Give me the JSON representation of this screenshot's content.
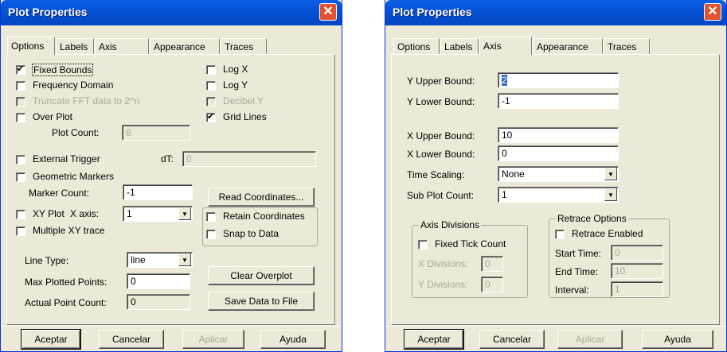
{
  "w1": {
    "title": "Plot Properties",
    "close": "✕",
    "tabs": [
      "Options",
      "Labels",
      "Axis",
      "Appearance",
      "Traces"
    ],
    "fixed_bounds": "Fixed Bounds",
    "frequency_domain": "Frequency Domain",
    "truncate_fft": "Truncate FFT data to 2^n",
    "over_plot": "Over Plot",
    "plot_count_label": "Plot Count:",
    "plot_count_value": "8",
    "log_x": "Log X",
    "log_y": "Log Y",
    "decibel_y": "Decibel Y",
    "grid_lines": "Grid Lines",
    "external_trigger": "External Trigger",
    "dt_label": "dT:",
    "dt_value": "0",
    "geometric_markers": "Geometric Markers",
    "marker_count_label": "Marker Count:",
    "marker_count_value": "-1",
    "read_coordinates": "Read Coordinates...",
    "xy_plot": "XY Plot",
    "x_axis_label": "X axis:",
    "x_axis_value": "1",
    "retain_coordinates": "Retain Coordinates",
    "multiple_xy_trace": "Multiple XY trace",
    "snap_to_data": "Snap to Data",
    "line_type_label": "Line Type:",
    "line_type_value": "line",
    "max_points_label": "Max Plotted Points:",
    "max_points_value": "0",
    "actual_count_label": "Actual Point Count:",
    "actual_count_value": "0",
    "clear_overplot": "Clear Overplot",
    "save_data": "Save Data to File",
    "ok": "Aceptar",
    "cancel": "Cancelar",
    "apply": "Aplicar",
    "help": "Ayuda"
  },
  "w2": {
    "title": "Plot Properties",
    "close": "✕",
    "tabs": [
      "Options",
      "Labels",
      "Axis",
      "Appearance",
      "Traces"
    ],
    "y_upper_label": "Y Upper Bound:",
    "y_upper_value": "2",
    "y_lower_label": "Y Lower Bound:",
    "y_lower_value": "-1",
    "x_upper_label": "X Upper Bound:",
    "x_upper_value": "10",
    "x_lower_label": "X Lower Bound:",
    "x_lower_value": "0",
    "time_scaling_label": "Time Scaling:",
    "time_scaling_value": "None",
    "sub_plot_label": "Sub Plot Count:",
    "sub_plot_value": "1",
    "axis_divisions": "Axis Divisions",
    "fixed_tick": "Fixed Tick Count",
    "x_div_label": "X Divisions:",
    "x_div_value": "0",
    "y_div_label": "Y Divisions:",
    "y_div_value": "0",
    "retrace_options": "Retrace Options",
    "retrace_enabled": "Retrace Enabled",
    "start_time_label": "Start Time:",
    "start_time_value": "0",
    "end_time_label": "End Time:",
    "end_time_value": "10",
    "interval_label": "Interval:",
    "interval_value": "1",
    "ok": "Aceptar",
    "cancel": "Cancelar",
    "apply": "Aplicar",
    "help": "Ayuda"
  }
}
